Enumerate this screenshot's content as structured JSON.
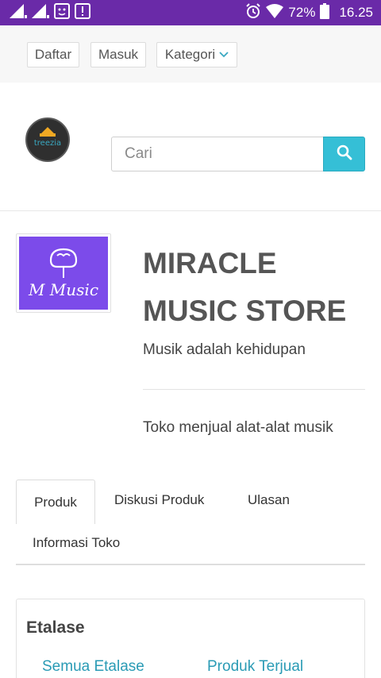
{
  "status_bar": {
    "battery": "72%",
    "time": "16.25",
    "icons": [
      "signal-icon",
      "signal-icon",
      "notification-icon",
      "alert-icon",
      "alarm-icon",
      "wifi-icon",
      "battery-icon"
    ]
  },
  "nav": {
    "daftar": "Daftar",
    "masuk": "Masuk",
    "kategori": "Kategori"
  },
  "brand": {
    "logo_text": "treezia"
  },
  "search": {
    "placeholder": "Cari"
  },
  "store": {
    "logo_text": "M Music",
    "name": "MIRACLE MUSIC STORE",
    "tagline": "Musik adalah kehidupan",
    "description": "Toko menjual alat-alat musik"
  },
  "tabs": [
    {
      "label": "Produk",
      "active": true
    },
    {
      "label": "Diskusi Produk",
      "active": false
    },
    {
      "label": "Ulasan",
      "active": false
    },
    {
      "label": "Informasi Toko",
      "active": false
    }
  ],
  "etalase": {
    "title": "Etalase",
    "links": [
      "Semua Etalase",
      "Produk Terjual"
    ]
  },
  "colors": {
    "status_bar": "#6a2aa8",
    "accent": "#35bfd6",
    "link": "#2a9bb5",
    "store_logo_bg": "#7c4bea"
  }
}
